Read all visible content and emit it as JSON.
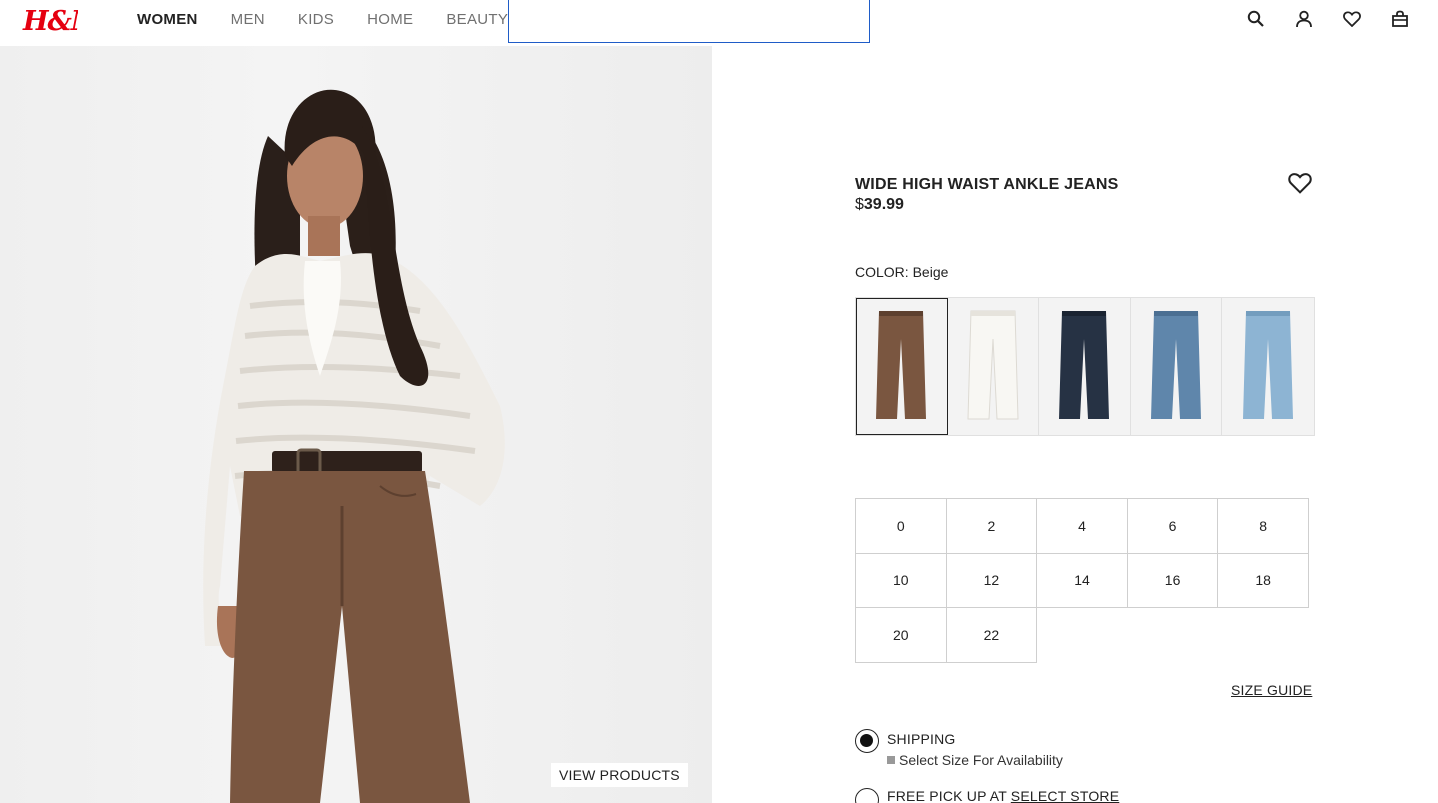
{
  "brand": {
    "logo_text": "H&M",
    "logo_color": "#e50010"
  },
  "nav": {
    "items": [
      {
        "label": "WOMEN",
        "active": true
      },
      {
        "label": "MEN",
        "active": false
      },
      {
        "label": "KIDS",
        "active": false
      },
      {
        "label": "HOME",
        "active": false
      },
      {
        "label": "BEAUTY",
        "active": false
      }
    ]
  },
  "search": {
    "value": ""
  },
  "header_icons": [
    "search-icon",
    "account-icon",
    "favorites-icon",
    "bag-icon"
  ],
  "hero": {
    "view_products_label": "VIEW PRODUCTS"
  },
  "product": {
    "title": "WIDE HIGH WAIST ANKLE JEANS",
    "price_currency": "$",
    "price_value": "39.99",
    "color_label": "COLOR:",
    "color_value": "Beige",
    "swatches": [
      {
        "name": "Beige",
        "color": "#7a5640",
        "selected": true
      },
      {
        "name": "White",
        "color": "#f2f1ec",
        "selected": false
      },
      {
        "name": "Dark denim",
        "color": "#263244",
        "selected": false
      },
      {
        "name": "Denim blue",
        "color": "#5f86ab",
        "selected": false
      },
      {
        "name": "Light denim",
        "color": "#8db4d3",
        "selected": false
      }
    ],
    "sizes": [
      [
        "0",
        "2",
        "4",
        "6",
        "8"
      ],
      [
        "10",
        "12",
        "14",
        "16",
        "18"
      ],
      [
        "20",
        "22"
      ]
    ],
    "size_guide_label": "SIZE GUIDE",
    "shipping_label": "SHIPPING",
    "shipping_sub": "Select Size For Availability",
    "pickup_label": "FREE PICK UP AT",
    "pickup_link": "SELECT STORE"
  }
}
